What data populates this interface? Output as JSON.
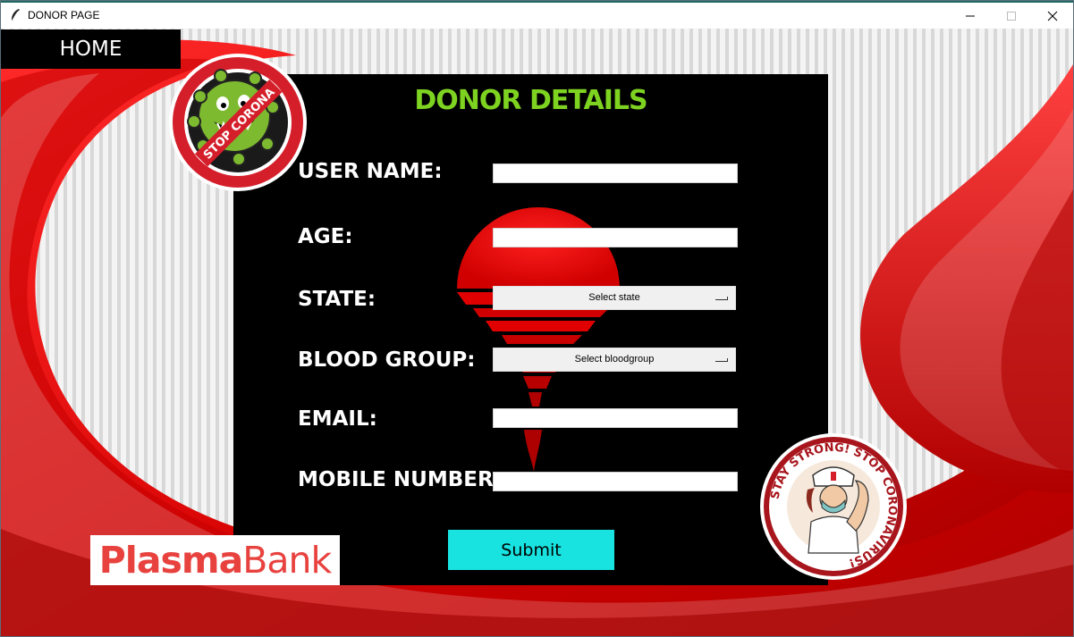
{
  "window": {
    "title": "DONOR PAGE"
  },
  "nav": {
    "home_label": "HOME"
  },
  "form": {
    "title": "DONOR DETAILS",
    "labels": {
      "user_name": "USER NAME:",
      "age": "AGE:",
      "state": "STATE:",
      "blood_group": "BLOOD GROUP:",
      "email": "EMAIL:",
      "mobile": "MOBILE NUMBER:"
    },
    "values": {
      "user_name": "",
      "age": "",
      "email": "",
      "mobile": ""
    },
    "state_select": "Select state",
    "blood_select": "Select bloodgroup",
    "submit_label": "Submit"
  },
  "logos": {
    "plasma_part1": "Plasma",
    "plasma_part2": "Bank",
    "stop_corona_text": "STOP CORONA",
    "stay_strong_text": "STAY STRONG! STOP CORONAVIRUS!"
  },
  "colors": {
    "title_green": "#7ed321",
    "submit_cyan": "#18e3e0",
    "blood_red": "#e00000",
    "brand_red": "#e8423f"
  },
  "icons": {
    "app_icon": "feather-icon",
    "minimize": "minimize-icon",
    "maximize": "maximize-icon",
    "close": "close-icon"
  }
}
